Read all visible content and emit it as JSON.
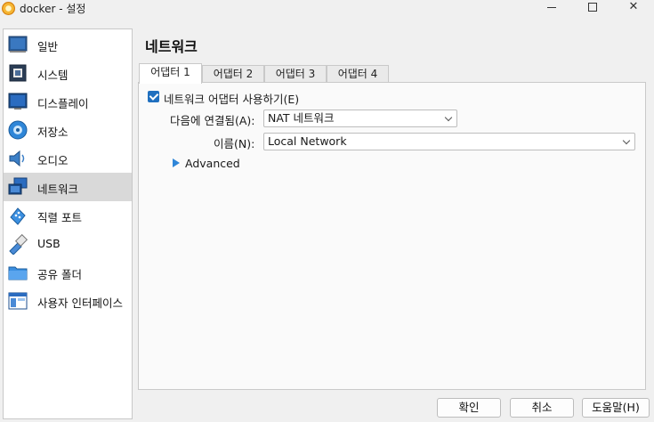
{
  "window": {
    "title": "docker - 설정",
    "controls": {
      "minimize": "minimize-icon",
      "maximize": "maximize-icon",
      "close": "✕"
    }
  },
  "sidebar": {
    "items": [
      {
        "label": "일반",
        "icon": "general-icon",
        "active": false
      },
      {
        "label": "시스템",
        "icon": "system-chip-icon",
        "active": false
      },
      {
        "label": "디스플레이",
        "icon": "display-monitor-icon",
        "active": false
      },
      {
        "label": "저장소",
        "icon": "storage-disk-icon",
        "active": false
      },
      {
        "label": "오디오",
        "icon": "audio-speaker-icon",
        "active": false
      },
      {
        "label": "네트워크",
        "icon": "network-icon",
        "active": true
      },
      {
        "label": "직렬 포트",
        "icon": "serial-port-icon",
        "active": false
      },
      {
        "label": "USB",
        "icon": "usb-icon",
        "active": false
      },
      {
        "label": "공유 폴더",
        "icon": "shared-folder-icon",
        "active": false
      },
      {
        "label": "사용자 인터페이스",
        "icon": "user-interface-icon",
        "active": false
      }
    ]
  },
  "main": {
    "title": "네트워크",
    "tabs": [
      {
        "label": "어댑터 1",
        "active": true
      },
      {
        "label": "어댑터 2",
        "active": false
      },
      {
        "label": "어댑터 3",
        "active": false
      },
      {
        "label": "어댑터 4",
        "active": false
      }
    ],
    "enable_adapter": {
      "label": "네트워크 어댑터 사용하기(E)",
      "checked": true
    },
    "attached_to": {
      "label": "다음에 연결됨(A):",
      "value": "NAT 네트워크"
    },
    "name": {
      "label": "이름(N):",
      "value": "Local Network"
    },
    "advanced": {
      "label": "Advanced",
      "expanded": false
    }
  },
  "buttons": {
    "ok": "확인",
    "cancel": "취소",
    "help": "도움말(H)"
  },
  "colors": {
    "accent": "#1f6fbf",
    "selected_item": "#d9d9d9",
    "window_bg": "#f0f0f0"
  }
}
